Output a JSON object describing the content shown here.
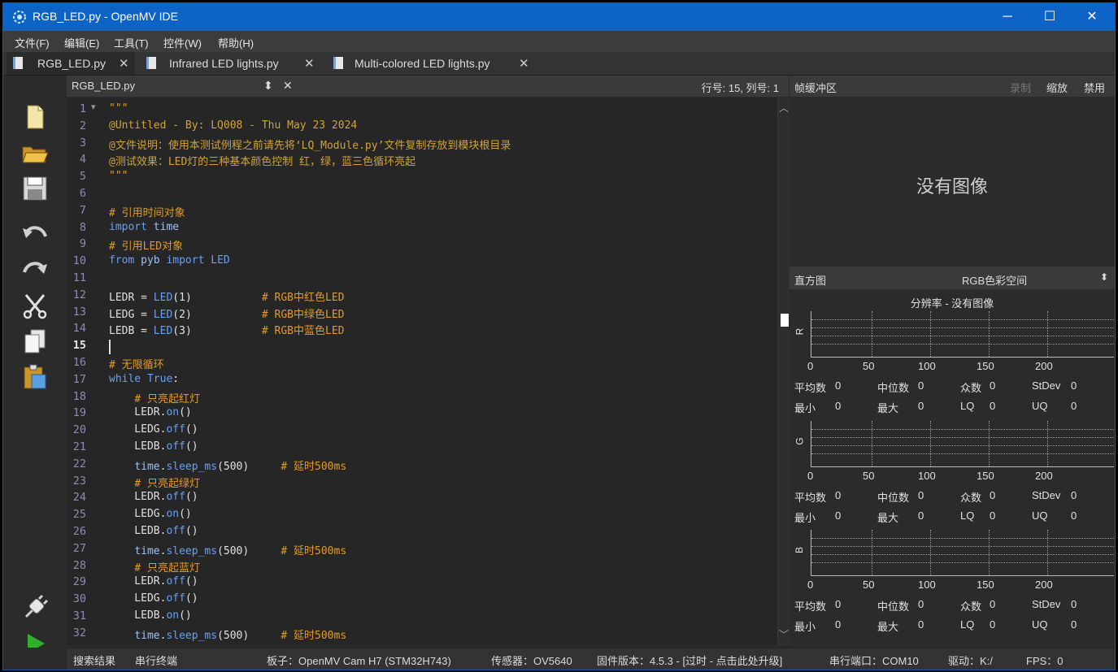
{
  "window": {
    "title": "RGB_LED.py - OpenMV IDE",
    "minimize": "─",
    "maximize": "☐",
    "close": "✕"
  },
  "menu": [
    {
      "label": "文件(F)"
    },
    {
      "label": "编辑(E)"
    },
    {
      "label": "工具(T)"
    },
    {
      "label": "控件(W)"
    },
    {
      "label": "帮助(H)"
    }
  ],
  "file_tabs": [
    {
      "label": "RGB_LED.py",
      "active": true
    },
    {
      "label": "Infrared LED lights.py",
      "active": false
    },
    {
      "label": "Multi-colored LED lights.py",
      "active": false
    }
  ],
  "close_glyph": "✕",
  "toolbar_icons": [
    "new-file-icon",
    "open-folder-icon",
    "save-icon",
    "undo-icon",
    "redo-icon",
    "cut-icon",
    "copy-icon",
    "paste-icon",
    "connect-icon",
    "run-icon"
  ],
  "editor": {
    "filename": "RGB_LED.py",
    "updown": "⬍",
    "cursor_pos": "行号: 15, 列号: 1",
    "current_line": 15,
    "fold_marker": "▾",
    "lines": [
      {
        "n": "1",
        "t": "\"\"\""
      },
      {
        "n": "2",
        "t": "@Untitled - By: LQ008 - Thu May 23 2024"
      },
      {
        "n": "3",
        "t": "@文件说明：使用本测试例程之前请先将‘LQ_Module.py’文件复制存放到模块根目录"
      },
      {
        "n": "4",
        "t": "@测试效果：LED灯的三种基本颜色控制 红，绿，蓝三色循环亮起"
      },
      {
        "n": "5",
        "t": "\"\"\""
      },
      {
        "n": "6",
        "t": ""
      },
      {
        "n": "7",
        "t": "# 引用时间对象"
      },
      {
        "n": "8",
        "t": "import time"
      },
      {
        "n": "9",
        "t": "# 引用LED对象"
      },
      {
        "n": "10",
        "t": "from pyb import LED"
      },
      {
        "n": "11",
        "t": ""
      },
      {
        "n": "12",
        "t": "LEDR = LED(1)           # RGB中红色LED"
      },
      {
        "n": "13",
        "t": "LEDG = LED(2)           # RGB中绿色LED"
      },
      {
        "n": "14",
        "t": "LEDB = LED(3)           # RGB中蓝色LED"
      },
      {
        "n": "15",
        "t": ""
      },
      {
        "n": "16",
        "t": "# 无限循环"
      },
      {
        "n": "17",
        "t": "while True:"
      },
      {
        "n": "18",
        "t": "    # 只亮起红灯"
      },
      {
        "n": "19",
        "t": "    LEDR.on()"
      },
      {
        "n": "20",
        "t": "    LEDG.off()"
      },
      {
        "n": "21",
        "t": "    LEDB.off()"
      },
      {
        "n": "22",
        "t": "    time.sleep_ms(500)     # 延时500ms"
      },
      {
        "n": "23",
        "t": "    # 只亮起绿灯"
      },
      {
        "n": "24",
        "t": "    LEDR.off()"
      },
      {
        "n": "25",
        "t": "    LEDG.on()"
      },
      {
        "n": "26",
        "t": "    LEDB.off()"
      },
      {
        "n": "27",
        "t": "    time.sleep_ms(500)     # 延时500ms"
      },
      {
        "n": "28",
        "t": "    # 只亮起蓝灯"
      },
      {
        "n": "29",
        "t": "    LEDR.off()"
      },
      {
        "n": "30",
        "t": "    LEDG.off()"
      },
      {
        "n": "31",
        "t": "    LEDB.on()"
      },
      {
        "n": "32",
        "t": "    time.sleep_ms(500)     # 延时500ms"
      }
    ]
  },
  "frame_buffer": {
    "title": "帧缓冲区",
    "record": "录制",
    "zoom": "缩放",
    "disable": "禁用",
    "placeholder": "没有图像"
  },
  "histogram": {
    "title": "直方图",
    "colorspace": "RGB色彩空间",
    "resolution": "分辨率 - 没有图像",
    "ticks": [
      "0",
      "50",
      "100",
      "150",
      "200"
    ],
    "channels": [
      {
        "name": "R",
        "stats": {
          "mean": "0",
          "median": "0",
          "mode": "0",
          "stdev": "0",
          "min": "0",
          "max": "0",
          "lq": "0",
          "uq": "0"
        }
      },
      {
        "name": "G",
        "stats": {
          "mean": "0",
          "median": "0",
          "mode": "0",
          "stdev": "0",
          "min": "0",
          "max": "0",
          "lq": "0",
          "uq": "0"
        }
      },
      {
        "name": "B",
        "stats": {
          "mean": "0",
          "median": "0",
          "mode": "0",
          "stdev": "0",
          "min": "0",
          "max": "0",
          "lq": "0",
          "uq": "0"
        }
      }
    ],
    "labels": {
      "mean": "平均数",
      "median": "中位数",
      "mode": "众数",
      "stdev": "StDev",
      "min": "最小",
      "max": "最大",
      "lq": "LQ",
      "uq": "UQ"
    }
  },
  "status": {
    "search_results": "搜索结果",
    "serial_terminal": "串行终端",
    "board": "板子：OpenMV Cam H7 (STM32H743)",
    "sensor": "传感器：OV5640",
    "firmware": "固件版本：4.5.3 - [过时 - 点击此处升级]",
    "serial_port": "串行端口：COM10",
    "drive": "驱动：K:/",
    "fps": "FPS：0"
  }
}
